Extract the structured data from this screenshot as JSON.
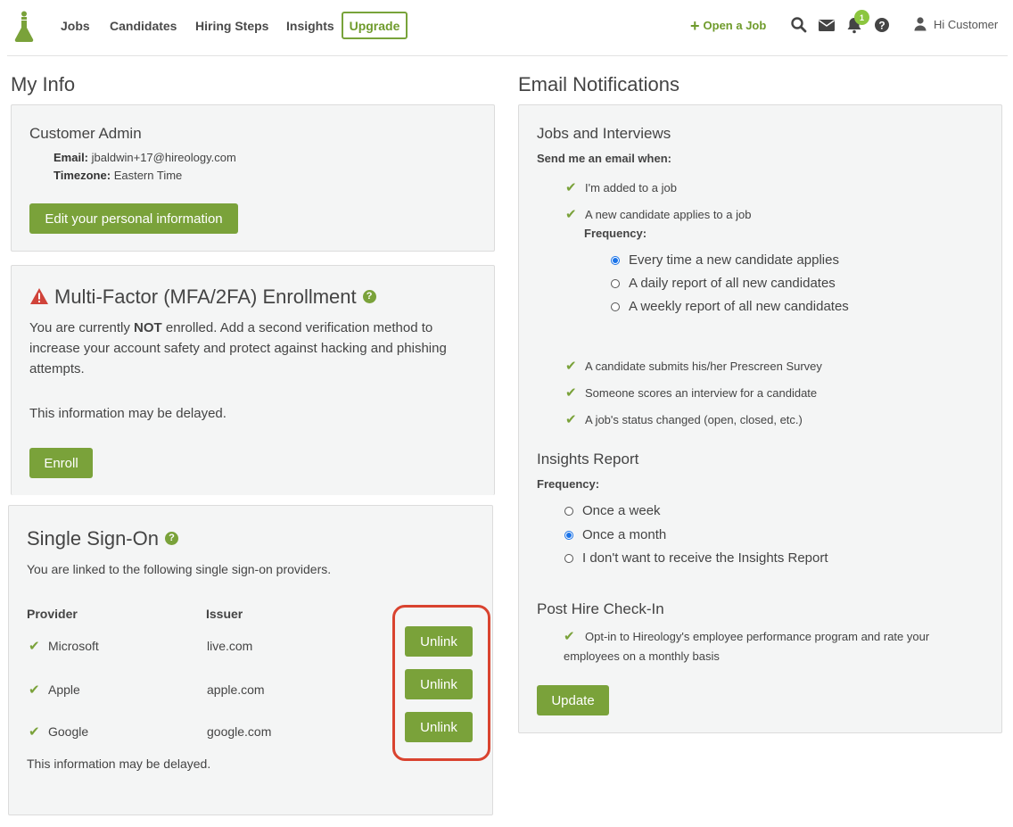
{
  "nav": {
    "items": [
      "Jobs",
      "Candidates",
      "Hiring Steps",
      "Insights"
    ],
    "upgrade": "Upgrade",
    "open_job": "Open a Job",
    "notification_count": "1",
    "greeting": "Hi Customer"
  },
  "my_info": {
    "title": "My Info",
    "role": "Customer Admin",
    "email_label": "Email:",
    "email_value": "jbaldwin+17@hireology.com",
    "timezone_label": "Timezone:",
    "timezone_value": "Eastern Time",
    "edit_button": "Edit your personal information"
  },
  "mfa": {
    "title": "Multi-Factor (MFA/2FA) Enrollment",
    "desc_before": "You are currently ",
    "desc_bold": "NOT",
    "desc_after": " enrolled. Add a second verification method to increase your account safety and protect against hacking and phishing attempts.",
    "delayed": "This information may be delayed.",
    "enroll_button": "Enroll"
  },
  "sso": {
    "title": "Single Sign-On",
    "desc": "You are linked to the following single sign-on providers.",
    "col_provider": "Provider",
    "col_issuer": "Issuer",
    "rows": [
      {
        "provider": "Microsoft",
        "issuer": "live.com",
        "action": "Unlink"
      },
      {
        "provider": "Apple",
        "issuer": "apple.com",
        "action": "Unlink"
      },
      {
        "provider": "Google",
        "issuer": "google.com",
        "action": "Unlink"
      }
    ],
    "delayed": "This information may be delayed."
  },
  "email_notifications": {
    "title": "Email Notifications",
    "jobs_title": "Jobs and Interviews",
    "send_label": "Send me an email when:",
    "checks_top": [
      "I'm added to a job",
      "A new candidate applies to a job"
    ],
    "frequency_label": "Frequency:",
    "freq_options": [
      "Every time a new candidate applies",
      "A daily report of all new candidates",
      "A weekly report of all new candidates"
    ],
    "freq_selected": 0,
    "checks_bottom": [
      "A candidate submits his/her Prescreen Survey",
      "Someone scores an interview for a candidate",
      "A job's status changed (open, closed, etc.)"
    ],
    "insights_title": "Insights Report",
    "insights_frequency_label": "Frequency:",
    "insights_options": [
      "Once a week",
      "Once a month",
      "I don't want to receive the Insights Report"
    ],
    "insights_selected": 1,
    "post_hire_title": "Post Hire Check-In",
    "post_hire_text": "Opt-in to Hireology's employee performance program and rate your employees on a monthly basis",
    "update_button": "Update"
  }
}
